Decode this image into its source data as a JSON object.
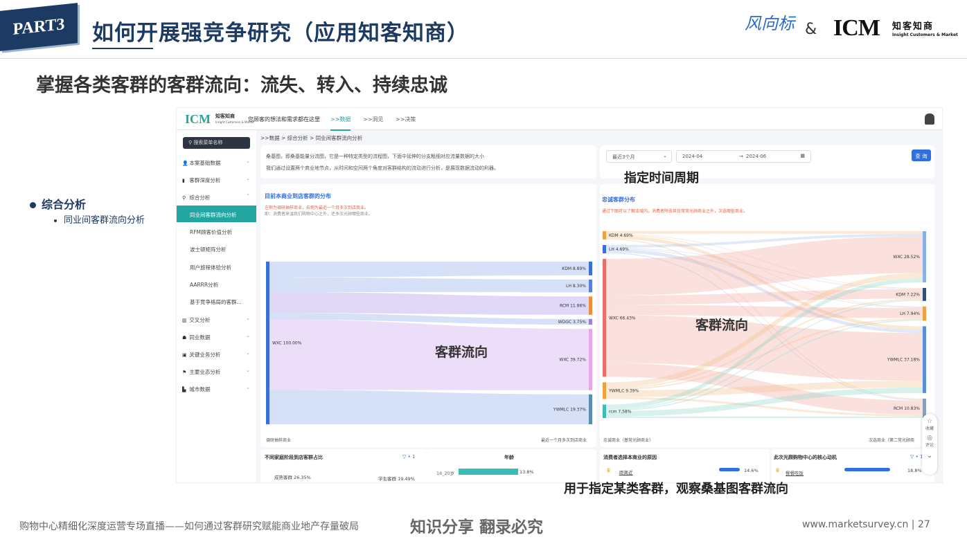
{
  "slide": {
    "part_badge": "PART3",
    "title": "如何开展强竞争研究（应用知客知商）",
    "subtitle": "掌握各类客群的客群流向：流失、转入、持续忠诚",
    "logo_fwb": "风向标",
    "logo_amp": "&",
    "logo_icm": "ICM",
    "logo_cn": "知客知商",
    "logo_en": "Insight Customers & Market",
    "left_bullet": "综合分析",
    "left_sub": "同业间客群流向分析",
    "footer_left": "购物中心精细化深度运营专场直播——如何通过客群研究赋能商业地产存量破局",
    "footer_center": "知识分享 翻录必究",
    "footer_right": "www.marketsurvey.cn  |  27",
    "callout_time": "指定时间周期",
    "callout_flow_left": "客群流向",
    "callout_flow_right": "客群流向",
    "callout_bottom": "用于指定某类客群，观察桑基图客群流向"
  },
  "app": {
    "brand": "ICM",
    "brand_cn": "知客知商",
    "brand_en": "Insight Customers & Market",
    "tagline": "您顾客的想法和需求都在这里",
    "nav": [
      ">>数据",
      ">>洞见",
      ">>决策"
    ],
    "search_placeholder": "搜索菜单名称",
    "sidebar_top": [
      {
        "icon": "user-icon",
        "glyph": "👤",
        "label": "本案基础数据"
      },
      {
        "icon": "bar-chart-icon",
        "glyph": "▮",
        "label": "客群深度分析"
      },
      {
        "icon": "search-analysis-icon",
        "glyph": "⚲",
        "label": "综合分析"
      }
    ],
    "sidebar_sub": [
      "同业间客群流向分析",
      "RFM顾客价值分析",
      "波士顿矩阵分析",
      "用户旅程体验分析",
      "AARRR分析",
      "基于竞争格局的客群..."
    ],
    "sidebar_bottom": [
      {
        "icon": "cross-icon",
        "glyph": "▥",
        "label": "交叉分析"
      },
      {
        "icon": "peer-icon",
        "glyph": "☗",
        "label": "同业数据"
      },
      {
        "icon": "key-business-icon",
        "glyph": "▣",
        "label": "关键业务分析"
      },
      {
        "icon": "flag-icon",
        "glyph": "⚑",
        "label": "主要业态分析"
      },
      {
        "icon": "city-icon",
        "glyph": "▙",
        "label": "城市数据"
      }
    ],
    "breadcrumb": ">>数据  >  综合分析  >  同业间客群流向分析",
    "description_1": "桑基图，即桑基能量分流图，它是一种特定类型的流程图，下面中延伸的分支粗细对应流量数据的大小",
    "description_2": "我们通过设置两个商业地节点，从时间和空间两个角度对客群结构的流动进行分析，是展现数据流动的利器。",
    "period_select": "最近3个月",
    "date_from": "2024-04",
    "date_arrow": "→",
    "date_to": "2024-06",
    "query_button": "查 询",
    "left_chart": {
      "title": "目前本商业到店客群的分布",
      "note1": "左侧为调研抽样商业，右侧为最近一个月多次到店商业。",
      "note2": "即：消费者来温我们购物中心之外，还多次光顾哪些商业。",
      "foot_left": "调研抽样商业",
      "foot_right": "最近一个月多次到店商业"
    },
    "right_chart": {
      "title": "忠诚客群分布",
      "note1": "通过下图可以了解流域内，消费者除去其日常常光顾商业之外，次选哪些商业。",
      "foot_left": "忠诚商业（基常光顾商业）",
      "foot_right": "次选商业（第二常光顾商"
    },
    "bottom_cards": [
      {
        "title": "不同家庭阶段到店客群占比",
        "filter": "▽ • 1",
        "row1_label": "成熟客群 26.35%",
        "row1_right": "学生客群 19.49%"
      },
      {
        "title": "年龄",
        "row_label": "16_20岁",
        "row_value": "13.8%"
      },
      {
        "title": "消费者选择本商业的原因",
        "row_label": "距离近",
        "row_value": "14.6%"
      },
      {
        "title": "此次光顾购物中心的核心动机",
        "filter": "▽ • 1",
        "row_label": "餐餐吃饭",
        "row_value": "18.8%"
      }
    ],
    "float_tools": [
      "☆",
      "收藏",
      "◎",
      "评论",
      "⌄"
    ]
  },
  "chart_data": [
    {
      "type": "sankey",
      "title": "目前本商业到店客群的分布",
      "source_nodes": [
        {
          "name": "WXC",
          "value": 100.0
        }
      ],
      "target_nodes": [
        {
          "name": "KDM",
          "value": 8.89
        },
        {
          "name": "LH",
          "value": 8.3
        },
        {
          "name": "RCM",
          "value": 11.86
        },
        {
          "name": "WDGC",
          "value": 3.75
        },
        {
          "name": "WXC",
          "value": 39.72
        },
        {
          "name": "YWMLC",
          "value": 19.37
        }
      ],
      "colors": [
        "#b5c8f3",
        "#3a6fd8",
        "#e8a6e6",
        "#f0a8a0"
      ]
    },
    {
      "type": "sankey",
      "title": "忠诚客群分布",
      "source_nodes": [
        {
          "name": "KDM",
          "value": 4.69
        },
        {
          "name": "LH",
          "value": 4.69
        },
        {
          "name": "WXC",
          "value": 66.43
        },
        {
          "name": "YWMLC",
          "value": 9.39
        },
        {
          "name": "rcm",
          "value": 7.58
        }
      ],
      "target_nodes": [
        {
          "name": "WXC",
          "value": 28.52
        },
        {
          "name": "KDM",
          "value": 7.22
        },
        {
          "name": "LH",
          "value": 7.94
        },
        {
          "name": "YWMLC",
          "value": 37.18
        },
        {
          "name": "RCM",
          "value": 10.83
        }
      ]
    }
  ]
}
